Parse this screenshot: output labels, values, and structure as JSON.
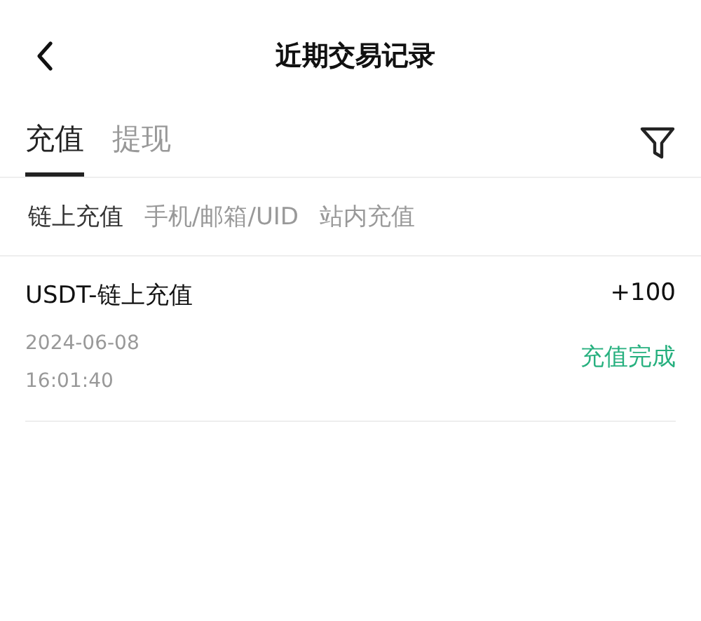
{
  "header": {
    "title": "近期交易记录"
  },
  "tabs": [
    {
      "label": "充值",
      "selected": true
    },
    {
      "label": "提现",
      "selected": false
    }
  ],
  "sub_tabs": [
    {
      "label": "链上充值",
      "selected": true
    },
    {
      "label": "手机/邮箱/UID",
      "selected": false
    },
    {
      "label": "站内充值",
      "selected": false
    }
  ],
  "records": [
    {
      "title": "USDT-链上充值",
      "amount": "+100",
      "date": "2024-06-08",
      "time": "16:01:40",
      "status": "充值完成"
    }
  ]
}
